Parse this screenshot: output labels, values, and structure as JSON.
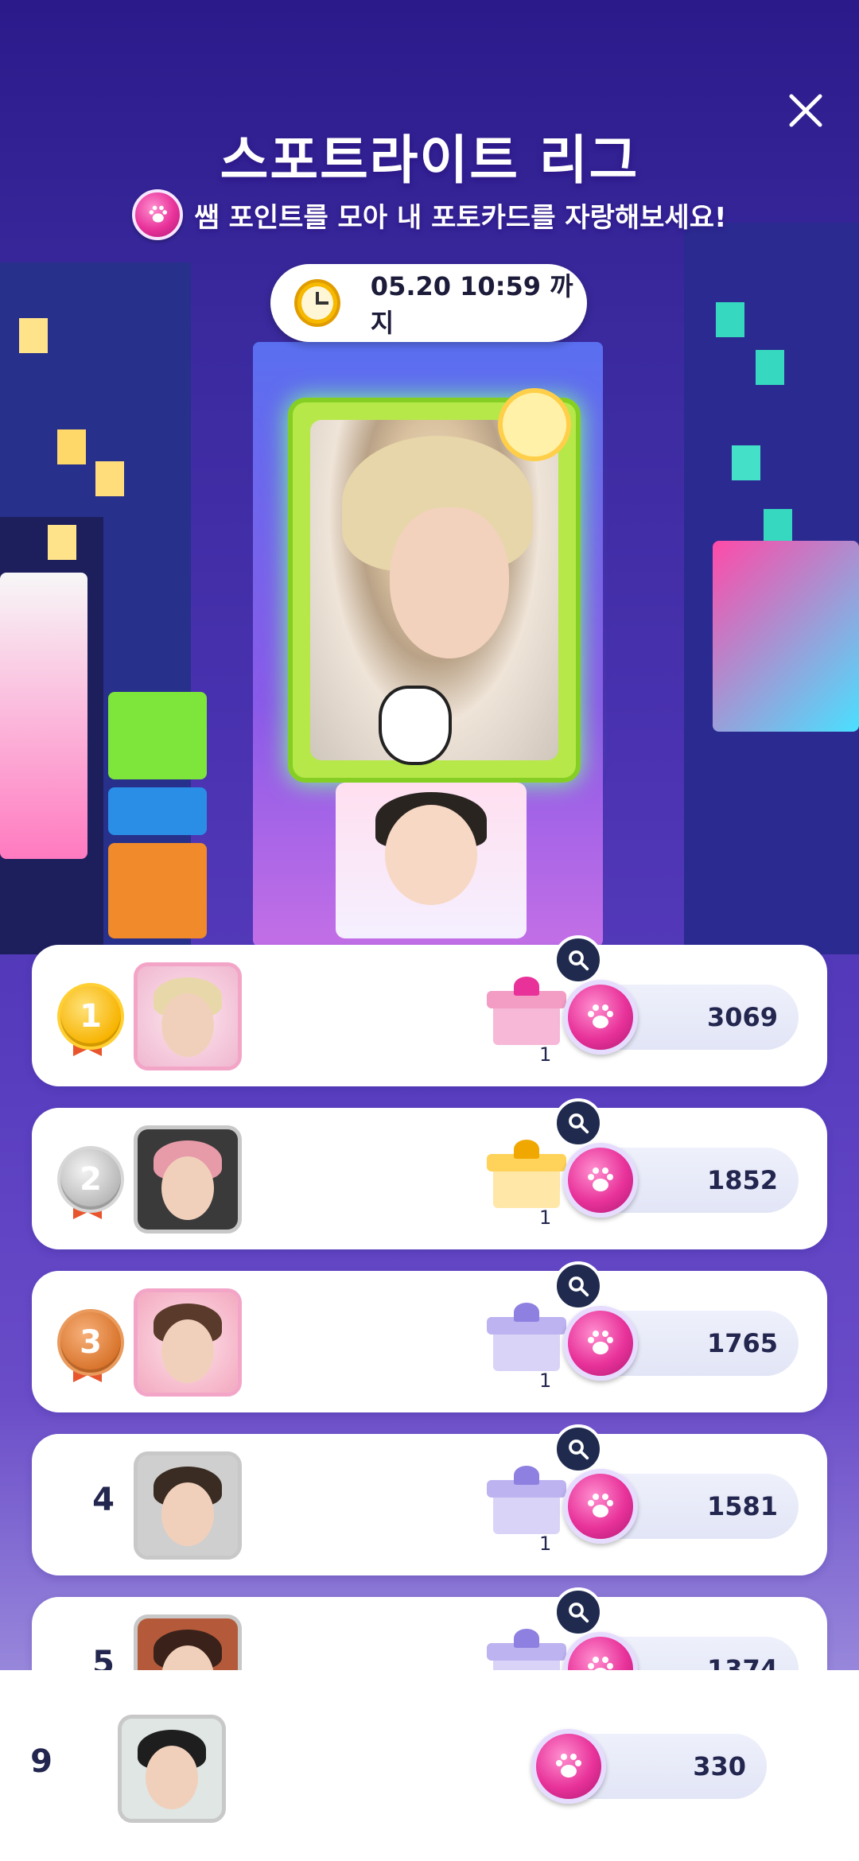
{
  "header": {
    "title": "스포트라이트 리그",
    "subtitle": "쌤 포인트를 모아 내 포토카드를 자랑해보세요!",
    "deadline": "05.20 10:59 까지"
  },
  "ranks": [
    {
      "rank": "1",
      "score": "3069",
      "gift_count": "1"
    },
    {
      "rank": "2",
      "score": "1852",
      "gift_count": "1"
    },
    {
      "rank": "3",
      "score": "1765",
      "gift_count": "1"
    },
    {
      "rank": "4",
      "score": "1581",
      "gift_count": "1"
    },
    {
      "rank": "5",
      "score": "1374"
    }
  ],
  "my_rank": {
    "rank": "9",
    "score": "330"
  },
  "colors": {
    "accent_pink": "#e8329a",
    "navy": "#23264e"
  }
}
